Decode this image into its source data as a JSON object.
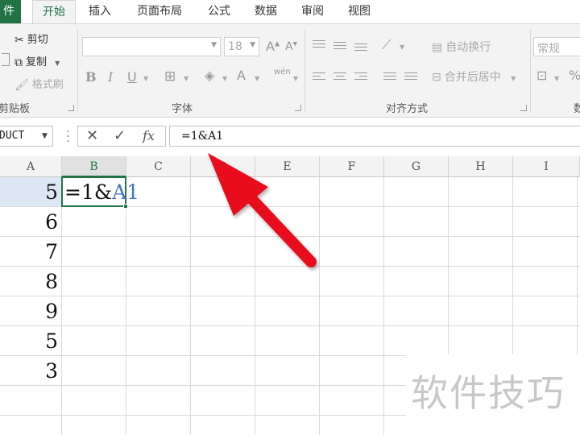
{
  "ribbon_tabs": {
    "file": "件",
    "tabs": [
      "开始",
      "插入",
      "页面布局",
      "公式",
      "数据",
      "审阅",
      "视图"
    ]
  },
  "clipboard": {
    "label": "剪贴板",
    "cut": "剪切",
    "copy": "复制",
    "format_painter": "格式刷"
  },
  "font": {
    "label": "字体",
    "size": "18",
    "bold": "B",
    "italic": "I",
    "underline": "U",
    "font_color_glyph": "A",
    "phonetic_glyph": "wén"
  },
  "alignment": {
    "label": "对齐方式",
    "wrap_text": "自动换行",
    "merge_center": "合并后居中"
  },
  "number": {
    "format": "常规",
    "label_partial": "数",
    "percent": "%"
  },
  "formula_bar": {
    "name_box": "DUCT",
    "cancel": "✕",
    "enter": "✓",
    "fx": "fx",
    "formula": "=1&A1"
  },
  "columns": [
    "A",
    "B",
    "C",
    "D",
    "E",
    "F",
    "G",
    "H",
    "I"
  ],
  "cells_a": [
    "5",
    "6",
    "7",
    "8",
    "9",
    "5",
    "3"
  ],
  "editing_cell": {
    "prefix": "=1&",
    "ref": "A1"
  },
  "watermark": "软件技巧",
  "colors": {
    "accent": "#217346",
    "ref_blue": "#4472c4",
    "arrow_red": "#e8101a"
  }
}
